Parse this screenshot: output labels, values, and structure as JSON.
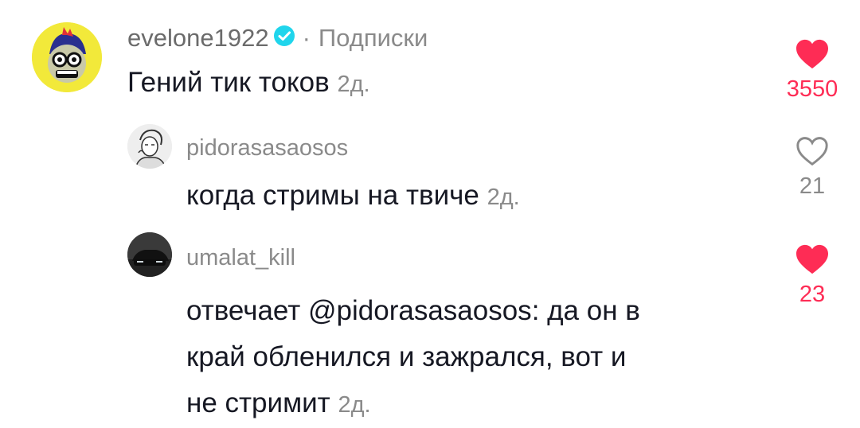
{
  "colors": {
    "like_active": "#fe2c55",
    "verified": "#20d5ec",
    "muted": "#8a8a8a"
  },
  "comments": [
    {
      "username": "evelone1922",
      "verified": true,
      "separator": "·",
      "tag": "Подписки",
      "text": "Гений тик токов",
      "time": "2д.",
      "likes": "3550",
      "liked": true,
      "avatar_icon": "cartoon-avatar-icon"
    },
    {
      "username": "pidorasasaosos",
      "text": "когда стримы на твиче",
      "time": "2д.",
      "likes": "21",
      "liked": false,
      "avatar_icon": "sketch-avatar-icon"
    },
    {
      "username": "umalat_kill",
      "reply_prefix": "отвечает",
      "mention": "@pidorasasaosos",
      "text_line1": ": да он в",
      "text_line2": "край обленился и зажрался, вот и",
      "text_line3": "не стримит",
      "time": "2д.",
      "likes": "23",
      "liked": true,
      "avatar_icon": "car-avatar-icon"
    }
  ]
}
